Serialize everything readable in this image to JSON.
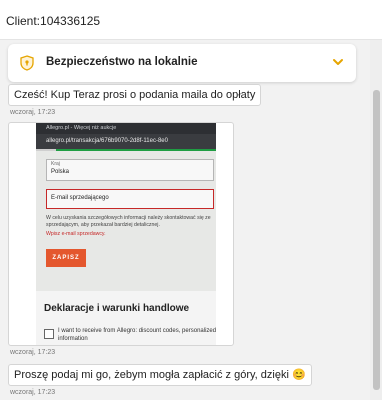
{
  "header": {
    "client": "Client:104336125"
  },
  "security": {
    "title": "Bezpieczeństwo na lokalnie"
  },
  "messages": [
    {
      "text": "Cześć! Kup Teraz prosi o podania maila do opłaty",
      "time": "wczoraj, 17:23"
    },
    {
      "time": "wczoraj, 17:23"
    },
    {
      "text": "Proszę podaj mi go, żebym mogła zapłacić z góry, dzięki 😊",
      "time": "wczoraj, 17:23"
    }
  ],
  "photo": {
    "tab_title": "Allegro.pl - Więcej niż aukcje",
    "url": "allegro.pl/transakcja/676b9070-2d8f-11ec-8e0",
    "country_label": "Kraj",
    "country_value": "Polska",
    "email_label": "E-mail sprzedającego",
    "info_text": "W celu uzyskania szczegółowych informacji należy skontaktować się ze sprzedającym, aby przekazał bardziej detalicznej.",
    "error_text": "Wpisz e-mail sprzedawcy.",
    "save_button": "ZAPISZ",
    "heading": "Deklaracje i warunki handlowe",
    "consent_text": "I want to receive from Allegro: discount codes, personalized information"
  }
}
